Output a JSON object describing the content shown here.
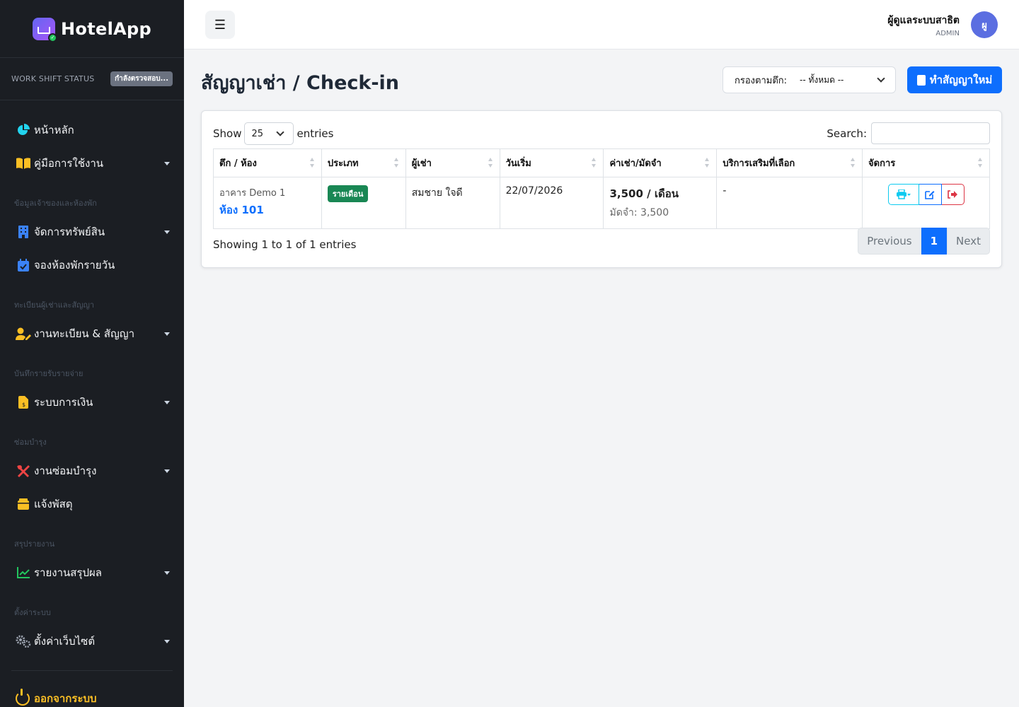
{
  "app": {
    "name": "HotelApp"
  },
  "shift": {
    "label": "WORK SHIFT STATUS",
    "status": "กำลังตรวจสอบ..."
  },
  "sidebar": {
    "items": [
      {
        "label": "หน้าหลัก",
        "icon": "pie-chart-icon",
        "color": "#22d3ee"
      },
      {
        "label": "คู่มือการใช้งาน",
        "icon": "book-icon",
        "color": "#fbbf24"
      },
      {
        "header": "ข้อมูลเจ้าของและห้องพัก"
      },
      {
        "label": "จัดการทรัพย์สิน",
        "icon": "building-icon",
        "color": "#3b82f6"
      },
      {
        "label": "จองห้องพักรายวัน",
        "icon": "calendar-icon",
        "color": "#3b82f6"
      },
      {
        "header": "ทะเบียนผู้เช่าและสัญญา"
      },
      {
        "label": "งานทะเบียน & สัญญา",
        "icon": "user-edit-icon",
        "color": "#fbbf24"
      },
      {
        "header": "บันทึกรายรับรายจ่าย"
      },
      {
        "label": "ระบบการเงิน",
        "icon": "invoice-icon",
        "color": "#fbbf24"
      },
      {
        "header": "ซ่อมบำรุง"
      },
      {
        "label": "งานซ่อมบำรุง",
        "icon": "tools-icon",
        "color": "#ef4444"
      },
      {
        "label": "แจ้งพัสดุ",
        "icon": "box-icon",
        "color": "#fbbf24"
      },
      {
        "header": "สรุปรายงาน"
      },
      {
        "label": "รายงานสรุปผล",
        "icon": "line-chart-icon",
        "color": "#22c55e"
      },
      {
        "header": "ตั้งค่าระบบ"
      },
      {
        "label": "ตั้งค่าเว็บไซต์",
        "icon": "gears-icon",
        "color": "#9ca3af"
      }
    ],
    "logout": "ออกจากระบบ"
  },
  "topbar": {
    "user_name": "ผู้ดูแลระบบสาธิต",
    "user_role": "ADMIN",
    "avatar": "ผู"
  },
  "page": {
    "title": "สัญญาเช่า / Check-in",
    "filter_label": "กรองตามตึก:",
    "filter_value": "-- ทั้งหมด --",
    "new_button": "ทำสัญญาใหม่"
  },
  "table": {
    "show_label": "Show",
    "length": "25",
    "entries_label": "entries",
    "search_label": "Search:",
    "columns": [
      "ตึก / ห้อง",
      "ประเภท",
      "ผู้เช่า",
      "วันเริ่ม",
      "ค่าเช่า/มัดจำ",
      "บริการเสริมที่เลือก",
      "จัดการ"
    ],
    "rows": [
      {
        "building": "อาคาร Demo 1",
        "room": "ห้อง 101",
        "type": "รายเดือน",
        "tenant": "สมชาย ใจดี",
        "start": "22/07/2026",
        "rent": "3,500 / เดือน",
        "deposit": "มัดจำ: 3,500",
        "services": "-"
      }
    ],
    "info": "Showing 1 to 1 of 1 entries",
    "pager": {
      "previous": "Previous",
      "current": "1",
      "next": "Next"
    }
  }
}
